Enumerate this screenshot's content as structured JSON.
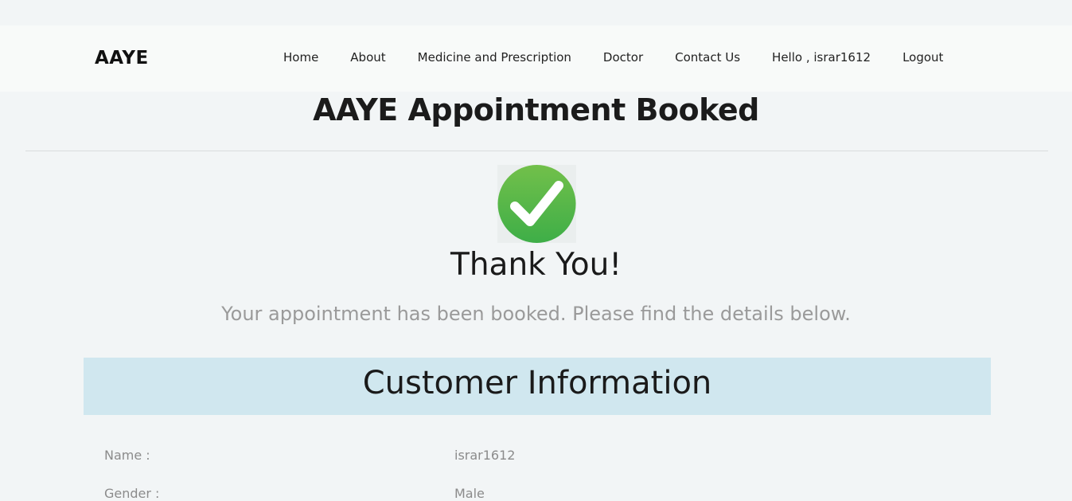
{
  "navbar": {
    "brand": "AAYE",
    "links": [
      {
        "label": "Home"
      },
      {
        "label": "About"
      },
      {
        "label": "Medicine and Prescription"
      },
      {
        "label": "Doctor"
      },
      {
        "label": "Contact Us"
      },
      {
        "label": "Hello , israr1612"
      },
      {
        "label": "Logout"
      }
    ]
  },
  "main": {
    "title": "AAYE Appointment Booked",
    "success_icon": "check-circle-icon",
    "thank_you": "Thank You!",
    "subtitle": "Your appointment has been booked. Please find the details below.",
    "section_title": "Customer Information",
    "rows": [
      {
        "label": "Name :",
        "value": "israr1612"
      },
      {
        "label": "Gender :",
        "value": "Male"
      }
    ]
  },
  "colors": {
    "accent_green": "#4fb84a",
    "section_bg": "#d0e7ef",
    "page_bg": "#f2f5f6"
  }
}
